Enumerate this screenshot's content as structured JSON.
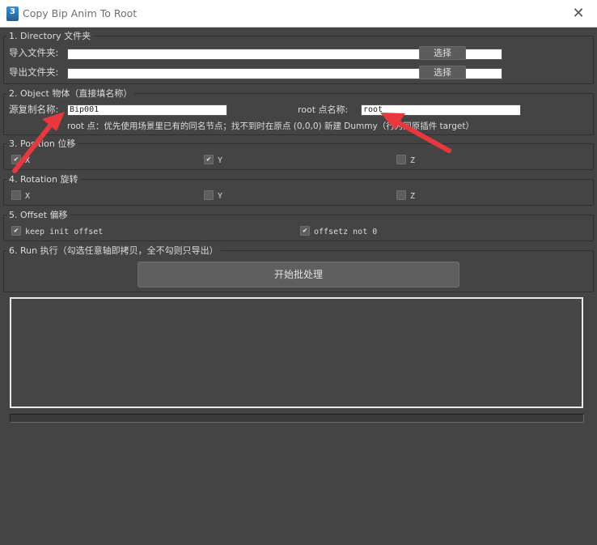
{
  "window": {
    "title": "Copy Bip Anim To Root",
    "app_icon_text": "3",
    "close_glyph": "✕"
  },
  "directory": {
    "title": "1. Directory  文件夹",
    "import_label": "导入文件夹:",
    "import_value": "",
    "export_label": "导出文件夹:",
    "export_value": "",
    "pick_label": "选择"
  },
  "object": {
    "title": "2. Object  物体（直接填名称）",
    "source_label": "源复制名称:",
    "source_value": "Bip001",
    "root_label": "root 点名称:",
    "root_value": "root",
    "hint": "root 点：优先使用场景里已有的同名节点；找不到时在原点 (0,0,0) 新建 Dummy（行为同原插件 target）"
  },
  "position": {
    "title": "3. Position  位移",
    "axes": [
      {
        "label": "X",
        "checked": true
      },
      {
        "label": "Y",
        "checked": true
      },
      {
        "label": "Z",
        "checked": false
      }
    ]
  },
  "rotation": {
    "title": "4. Rotation  旋转",
    "axes": [
      {
        "label": "X",
        "checked": false
      },
      {
        "label": "Y",
        "checked": false
      },
      {
        "label": "Z",
        "checked": false
      }
    ]
  },
  "offset": {
    "title": "5. Offset  偏移",
    "keep_init": {
      "label": "keep init offset",
      "checked": true
    },
    "offsetz": {
      "label": "offsetz not 0",
      "checked": true
    }
  },
  "run": {
    "title": "6. Run  执行（勾选任意轴即拷贝，全不勾则只导出）",
    "button_label": "开始批处理",
    "log_text": "",
    "progress": 0
  },
  "colors": {
    "annotation_arrow": "#e8383d",
    "background": "#444444"
  },
  "check_glyph": "✔"
}
